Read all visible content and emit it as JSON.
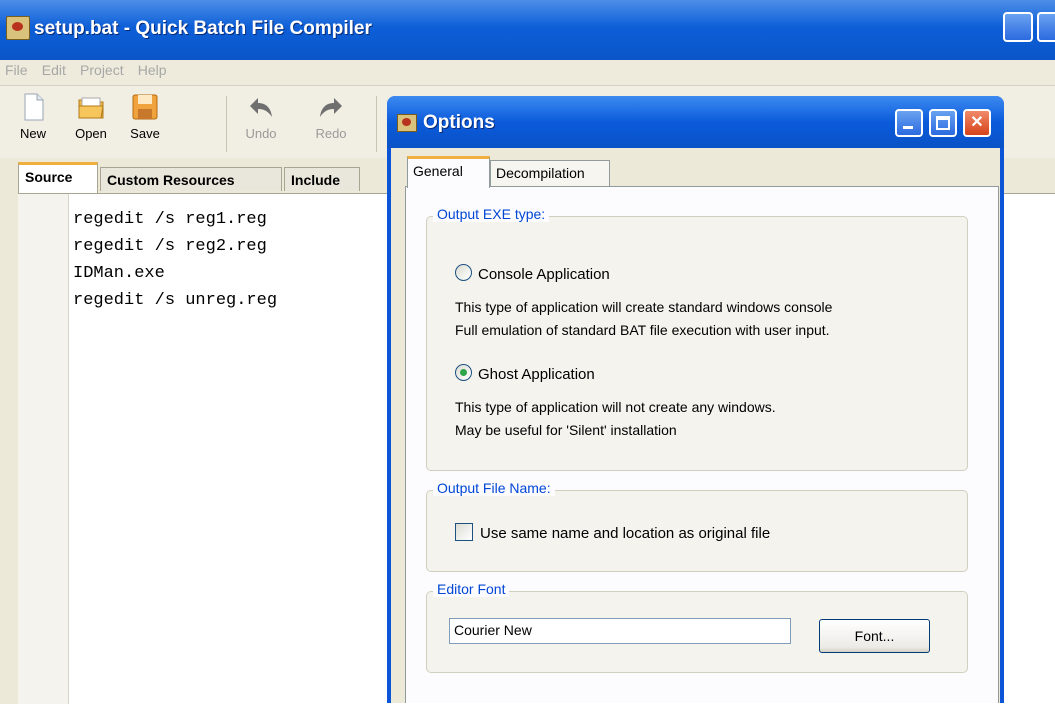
{
  "window": {
    "title": "setup.bat - Quick Batch File Compiler",
    "menu": [
      "File",
      "Edit",
      "Project",
      "Help"
    ]
  },
  "toolbar": {
    "new_label": "New",
    "open_label": "Open",
    "save_label": "Save",
    "undo_label": "Undo",
    "redo_label": "Redo"
  },
  "tabs": [
    "Source",
    "Custom Resources",
    "Include"
  ],
  "editor": {
    "lines": [
      "regedit /s reg1.reg",
      "regedit /s reg2.reg",
      "IDMan.exe",
      "regedit /s unreg.reg"
    ]
  },
  "dialog": {
    "title": "Options",
    "tabs": [
      "General",
      "Decompilation"
    ],
    "output_exe": {
      "legend": "Output EXE type:",
      "console_label": "Console Application",
      "console_desc_1": "This type of application will create standard windows console",
      "console_desc_2": "Full emulation of standard BAT file execution with user input.",
      "ghost_label": "Ghost Application",
      "ghost_desc_1": "This type of application will not create any windows.",
      "ghost_desc_2": "May be useful for 'Silent' installation",
      "selected": "Ghost Application"
    },
    "output_file": {
      "legend": "Output File Name:",
      "checkbox_label": "Use same name and location as original file",
      "checked": false
    },
    "editor_font": {
      "legend": "Editor Font",
      "value": "Courier New",
      "button_label": "Font..."
    }
  },
  "colors": {
    "titlebar": "#0d5fd8",
    "group_legend": "#0046d5",
    "radio_selected": "#2da44a"
  }
}
